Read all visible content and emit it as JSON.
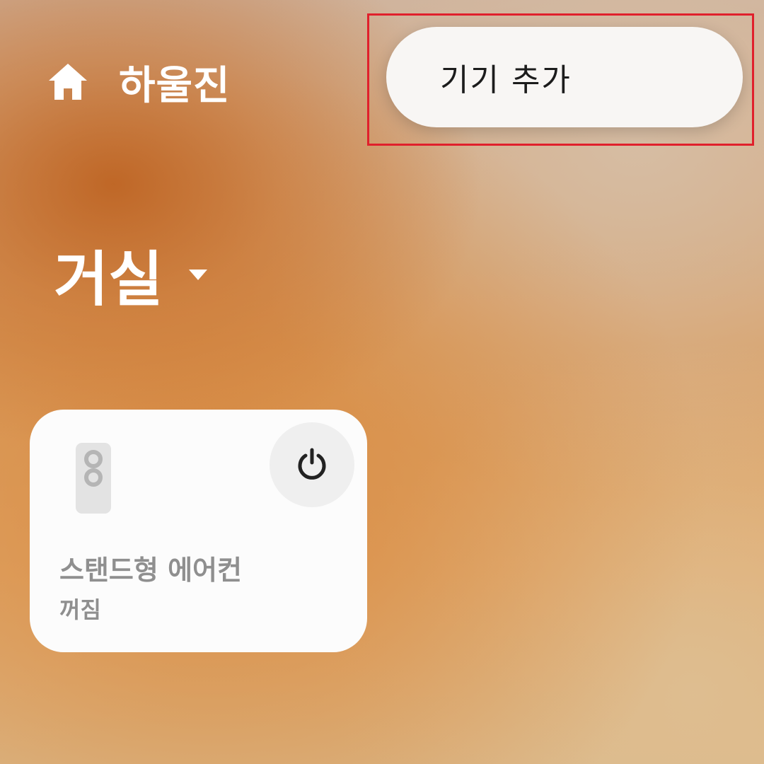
{
  "header": {
    "home_icon": "home-icon",
    "home_name": "하울진"
  },
  "popup_menu": {
    "items": [
      {
        "label": "기기 추가"
      }
    ],
    "highlight_color": "#e0202c"
  },
  "room": {
    "name": "거실",
    "dropdown_icon": "caret-down-icon"
  },
  "devices": [
    {
      "name": "스탠드형 에어컨",
      "status": "꺼짐",
      "icon": "standing-air-conditioner-icon",
      "power_icon": "power-icon"
    }
  ],
  "colors": {
    "card_background": "#fcfcfc",
    "popup_background": "#f8f6f4",
    "header_text": "#ffffff",
    "device_text": "#8f8f8f"
  }
}
